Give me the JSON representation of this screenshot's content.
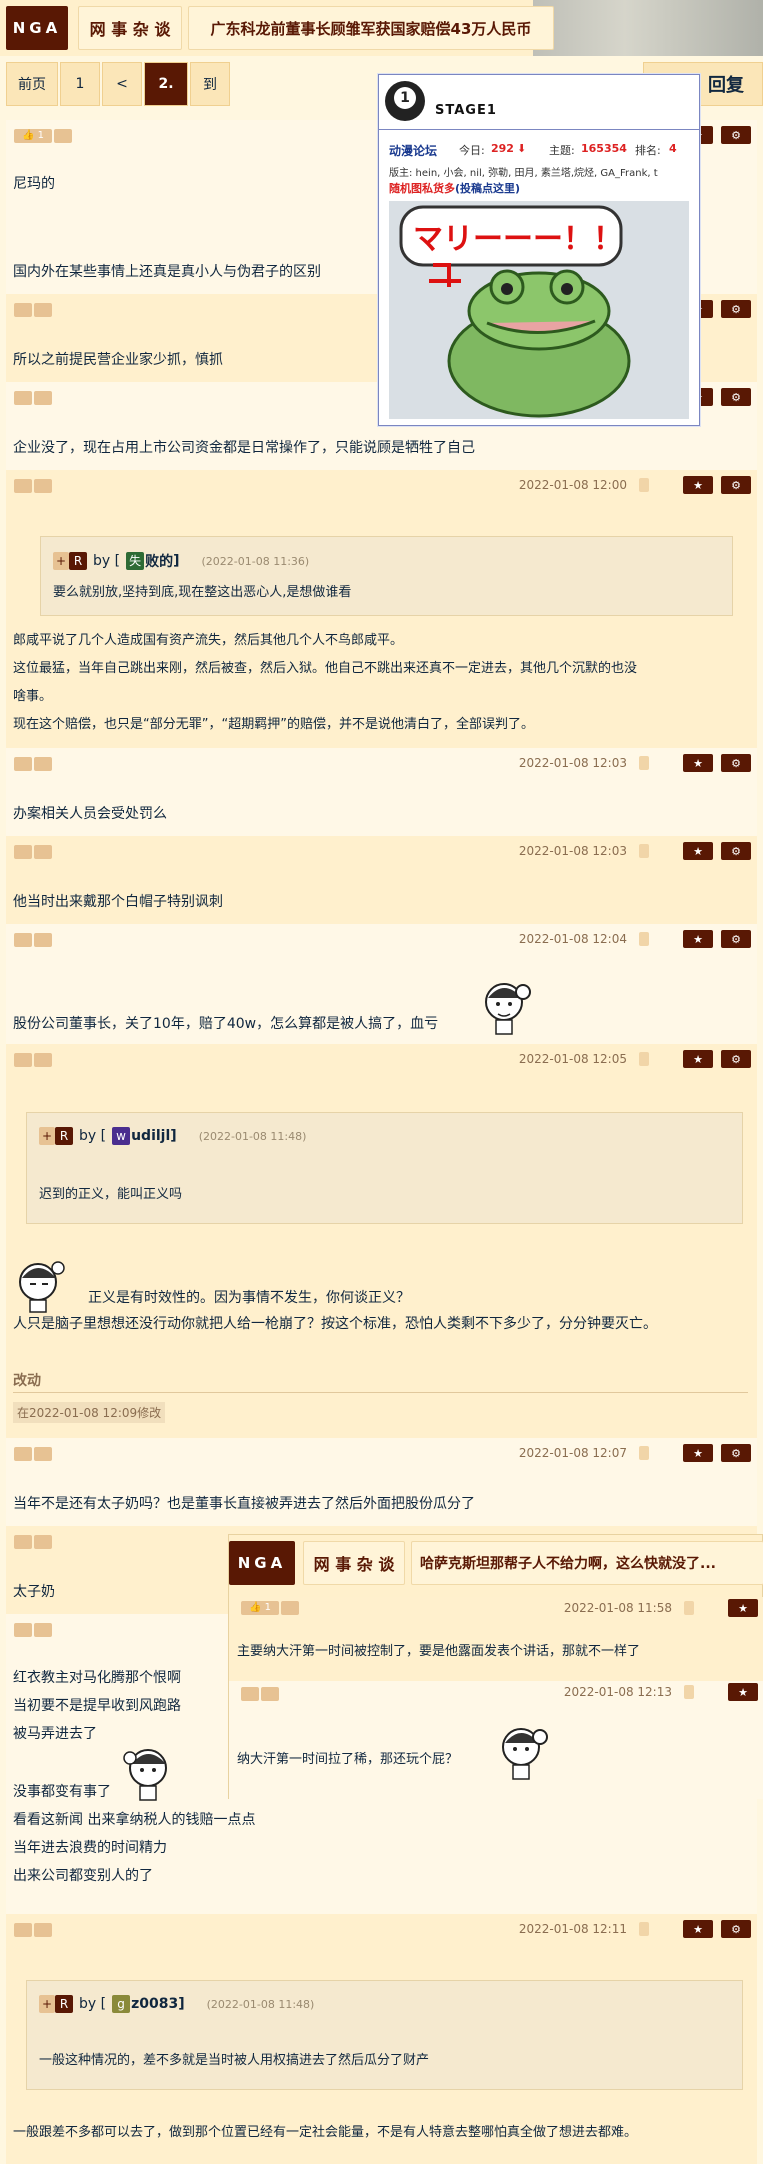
{
  "header": {
    "logo": "NGA",
    "section": "网 事 杂 谈",
    "title": "广东科龙前董事长顾雏军获国家赔偿43万人民币"
  },
  "pager": {
    "items": [
      "前页",
      "1",
      "<",
      "2.",
      "到"
    ],
    "current": "2.",
    "reply_label": "回复"
  },
  "posts": [
    {
      "id": "p1",
      "lines": [
        "尼玛的",
        "",
        "",
        "国内外在某些事情上还真是真小人与伪君子的区别"
      ],
      "rating": "1"
    },
    {
      "id": "p2",
      "lines": [
        "所以之前提民营企业家少抓，慎抓"
      ]
    },
    {
      "id": "p3",
      "lines": [
        "企业没了，现在占用上市公司资金都是日常操作了，只能说顾是牺牲了自己"
      ]
    },
    {
      "id": "p4",
      "time": "2022-01-08 12:00",
      "quote": {
        "avatar": "失",
        "name": "败的",
        "time": "(2022-01-08 11:36)",
        "body": "要么就别放,坚持到底,现在整这出恶心人,是想做谁看"
      },
      "lines": [
        "郎咸平说了几个人造成国有资产流失，然后其他几个人不鸟郎咸平。",
        "这位最猛，当年自己跳出来刚，然后被查，然后入狱。他自己不跳出来还真不一定进去，其他几个沉默的也没",
        "啥事。",
        "现在这个赔偿，也只是“部分无罪”，“超期羁押”的赔偿，并不是说他清白了，全部误判了。"
      ]
    },
    {
      "id": "p5",
      "time": "2022-01-08 12:03",
      "lines": [
        "办案相关人员会受处罚么"
      ]
    },
    {
      "id": "p6",
      "time": "2022-01-08 12:03",
      "lines": [
        "他当时出来戴那个白帽子特别讽刺"
      ]
    },
    {
      "id": "p7",
      "time": "2022-01-08 12:04",
      "lines": [
        "股份公司董事长，关了10年，赔了40w，怎么算都是被人搞了，血亏"
      ]
    },
    {
      "id": "p8",
      "time": "2022-01-08 12:05",
      "quote": {
        "avatar": "w",
        "name": "udiljl",
        "time": "(2022-01-08 11:48)",
        "body": "迟到的正义，能叫正义吗"
      },
      "lines": [
        "正义是有时效性的。因为事情不发生，你何谈正义？",
        "人只是脑子里想想还没行动你就把人给一枪崩了？按这个标准，恐怕人类剩不下多少了，分分钟要灭亡。"
      ],
      "edit_label": "改动",
      "edit_note": "在2022-01-08 12:09修改"
    },
    {
      "id": "p9",
      "time": "2022-01-08 12:07",
      "lines": [
        "当年不是还有太子奶吗？也是董事长直接被弄进去了然后外面把股份瓜分了"
      ]
    },
    {
      "id": "p10",
      "lines": [
        "太子奶"
      ]
    },
    {
      "id": "p11",
      "lines": [
        "红衣教主对马化腾那个恨啊",
        "当初要不是提早收到风跑路",
        "被马弄进去了",
        "",
        "没事都变有事了",
        "看看这新闻 出来拿纳税人的钱赔一点点",
        "当年进去浪费的时间精力",
        "出来公司都变别人的了"
      ]
    },
    {
      "id": "p12",
      "time": "2022-01-08 12:11",
      "quote": {
        "avatar": "g",
        "name": "z0083",
        "time": "(2022-01-08 11:48)",
        "body": "一般这种情况的，差不多就是当时被人用权搞进去了然后瓜分了财产"
      },
      "lines": [
        "一般跟差不多都可以去了，做到那个位置已经有一定社会能量，不是有人特意去整哪怕真全做了想进去都难。"
      ]
    }
  ],
  "stage_card": {
    "title": "STAGE1",
    "forum": "动漫论坛",
    "today_label": "今日:",
    "today": "292",
    "topics_label": "主题:",
    "topics": "165354",
    "rank_label": "排名:",
    "rank": "4",
    "mods": "版主: hein, 小会, nil, 弥勒, 田月, 素兰塔,烷烃, GA_Frank, t",
    "link_red": "随机图私货多",
    "link_blue": "(投稿点这里)",
    "bubble": "マリーーー！！"
  },
  "popup": {
    "logo": "NGA",
    "section": "网 事 杂 谈",
    "title": "哈萨克斯坦那帮子人不给力啊，这么快就没了...",
    "rows": [
      {
        "rating": "1",
        "time": "2022-01-08 11:58",
        "text": "主要纳大汗第一时间被控制了，要是他露面发表个讲话，那就不一样了"
      },
      {
        "time": "2022-01-08 12:13",
        "text": "纳大汗第一时间拉了稀，那还玩个屁？"
      }
    ]
  },
  "colors": {
    "brand": "#591804",
    "bg": "#fff7e0",
    "text": "#10273f",
    "accent_red": "#d22222",
    "link_blue": "#1a3a8f"
  }
}
